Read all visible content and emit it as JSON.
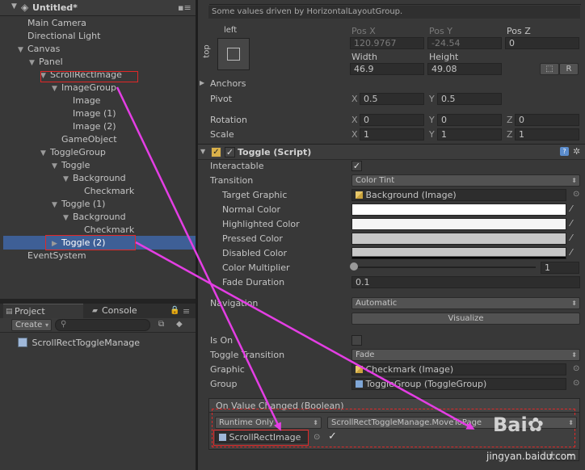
{
  "hierarchy": {
    "scene": "Untitled*",
    "items": [
      {
        "label": "Main Camera",
        "indent": 0,
        "arrow": ""
      },
      {
        "label": "Directional Light",
        "indent": 0,
        "arrow": ""
      },
      {
        "label": "Canvas",
        "indent": 0,
        "arrow": "▼"
      },
      {
        "label": "Panel",
        "indent": 1,
        "arrow": "▼"
      },
      {
        "label": "ScrollRectImage",
        "indent": 2,
        "arrow": "▼"
      },
      {
        "label": "ImageGroup",
        "indent": 3,
        "arrow": "▼"
      },
      {
        "label": "Image",
        "indent": 4,
        "arrow": ""
      },
      {
        "label": "Image (1)",
        "indent": 4,
        "arrow": ""
      },
      {
        "label": "Image (2)",
        "indent": 4,
        "arrow": ""
      },
      {
        "label": "GameObject",
        "indent": 3,
        "arrow": ""
      },
      {
        "label": "ToggleGroup",
        "indent": 2,
        "arrow": "▼"
      },
      {
        "label": "Toggle",
        "indent": 3,
        "arrow": "▼"
      },
      {
        "label": "Background",
        "indent": 4,
        "arrow": "▼"
      },
      {
        "label": "Checkmark",
        "indent": 5,
        "arrow": ""
      },
      {
        "label": "Toggle (1)",
        "indent": 3,
        "arrow": "▼"
      },
      {
        "label": "Background",
        "indent": 4,
        "arrow": "▼"
      },
      {
        "label": "Checkmark",
        "indent": 5,
        "arrow": ""
      },
      {
        "label": "Toggle (2)",
        "indent": 3,
        "arrow": "▶"
      },
      {
        "label": "EventSystem",
        "indent": 0,
        "arrow": ""
      }
    ]
  },
  "project": {
    "tab_project": "Project",
    "tab_console": "Console",
    "create": "Create",
    "asset": "ScrollRectToggleManage"
  },
  "rect": {
    "note": "Some values driven by HorizontalLayoutGroup.",
    "anchor_h": "left",
    "anchor_v": "top",
    "posx_label": "Pos X",
    "posy_label": "Pos Y",
    "posz_label": "Pos Z",
    "posx": "120.9767",
    "posy": "-24.54",
    "posz": "0",
    "width_label": "Width",
    "height_label": "Height",
    "width": "46.9",
    "height": "49.08",
    "r_button": "R",
    "anchors": "Anchors",
    "pivot": "Pivot",
    "pivot_x": "0.5",
    "pivot_y": "0.5",
    "rotation": "Rotation",
    "rot_x": "0",
    "rot_y": "0",
    "rot_z": "0",
    "scale": "Scale",
    "scale_x": "1",
    "scale_y": "1",
    "scale_z": "1",
    "x": "X",
    "y": "Y",
    "z": "Z"
  },
  "toggle": {
    "header": "Toggle (Script)",
    "interactable": "Interactable",
    "transition": "Transition",
    "transition_value": "Color Tint",
    "target_graphic": "Target Graphic",
    "target_graphic_value": "Background (Image)",
    "normal_color": "Normal Color",
    "highlighted_color": "Highlighted Color",
    "pressed_color": "Pressed Color",
    "disabled_color": "Disabled Color",
    "color_multiplier": "Color Multiplier",
    "color_multiplier_value": "1",
    "fade_duration": "Fade Duration",
    "fade_duration_value": "0.1",
    "navigation": "Navigation",
    "navigation_value": "Automatic",
    "visualize": "Visualize",
    "is_on": "Is On",
    "toggle_transition": "Toggle Transition",
    "toggle_transition_value": "Fade",
    "graphic": "Graphic",
    "graphic_value": "Checkmark (Image)",
    "group": "Group",
    "group_value": "ToggleGroup (ToggleGroup)",
    "event_header": "On Value Changed (Boolean)",
    "runtime": "Runtime Only",
    "function": "ScrollRectToggleManage.MoveToPage",
    "object": "ScrollRectImage",
    "plus": "+",
    "minus": "−",
    "check": "✓"
  },
  "watermark": "jingyan.baidu.com",
  "colors": {
    "selection": "#3e5f96",
    "annotation_red": "#e02828",
    "annotation_magenta": "#e43ee4"
  }
}
